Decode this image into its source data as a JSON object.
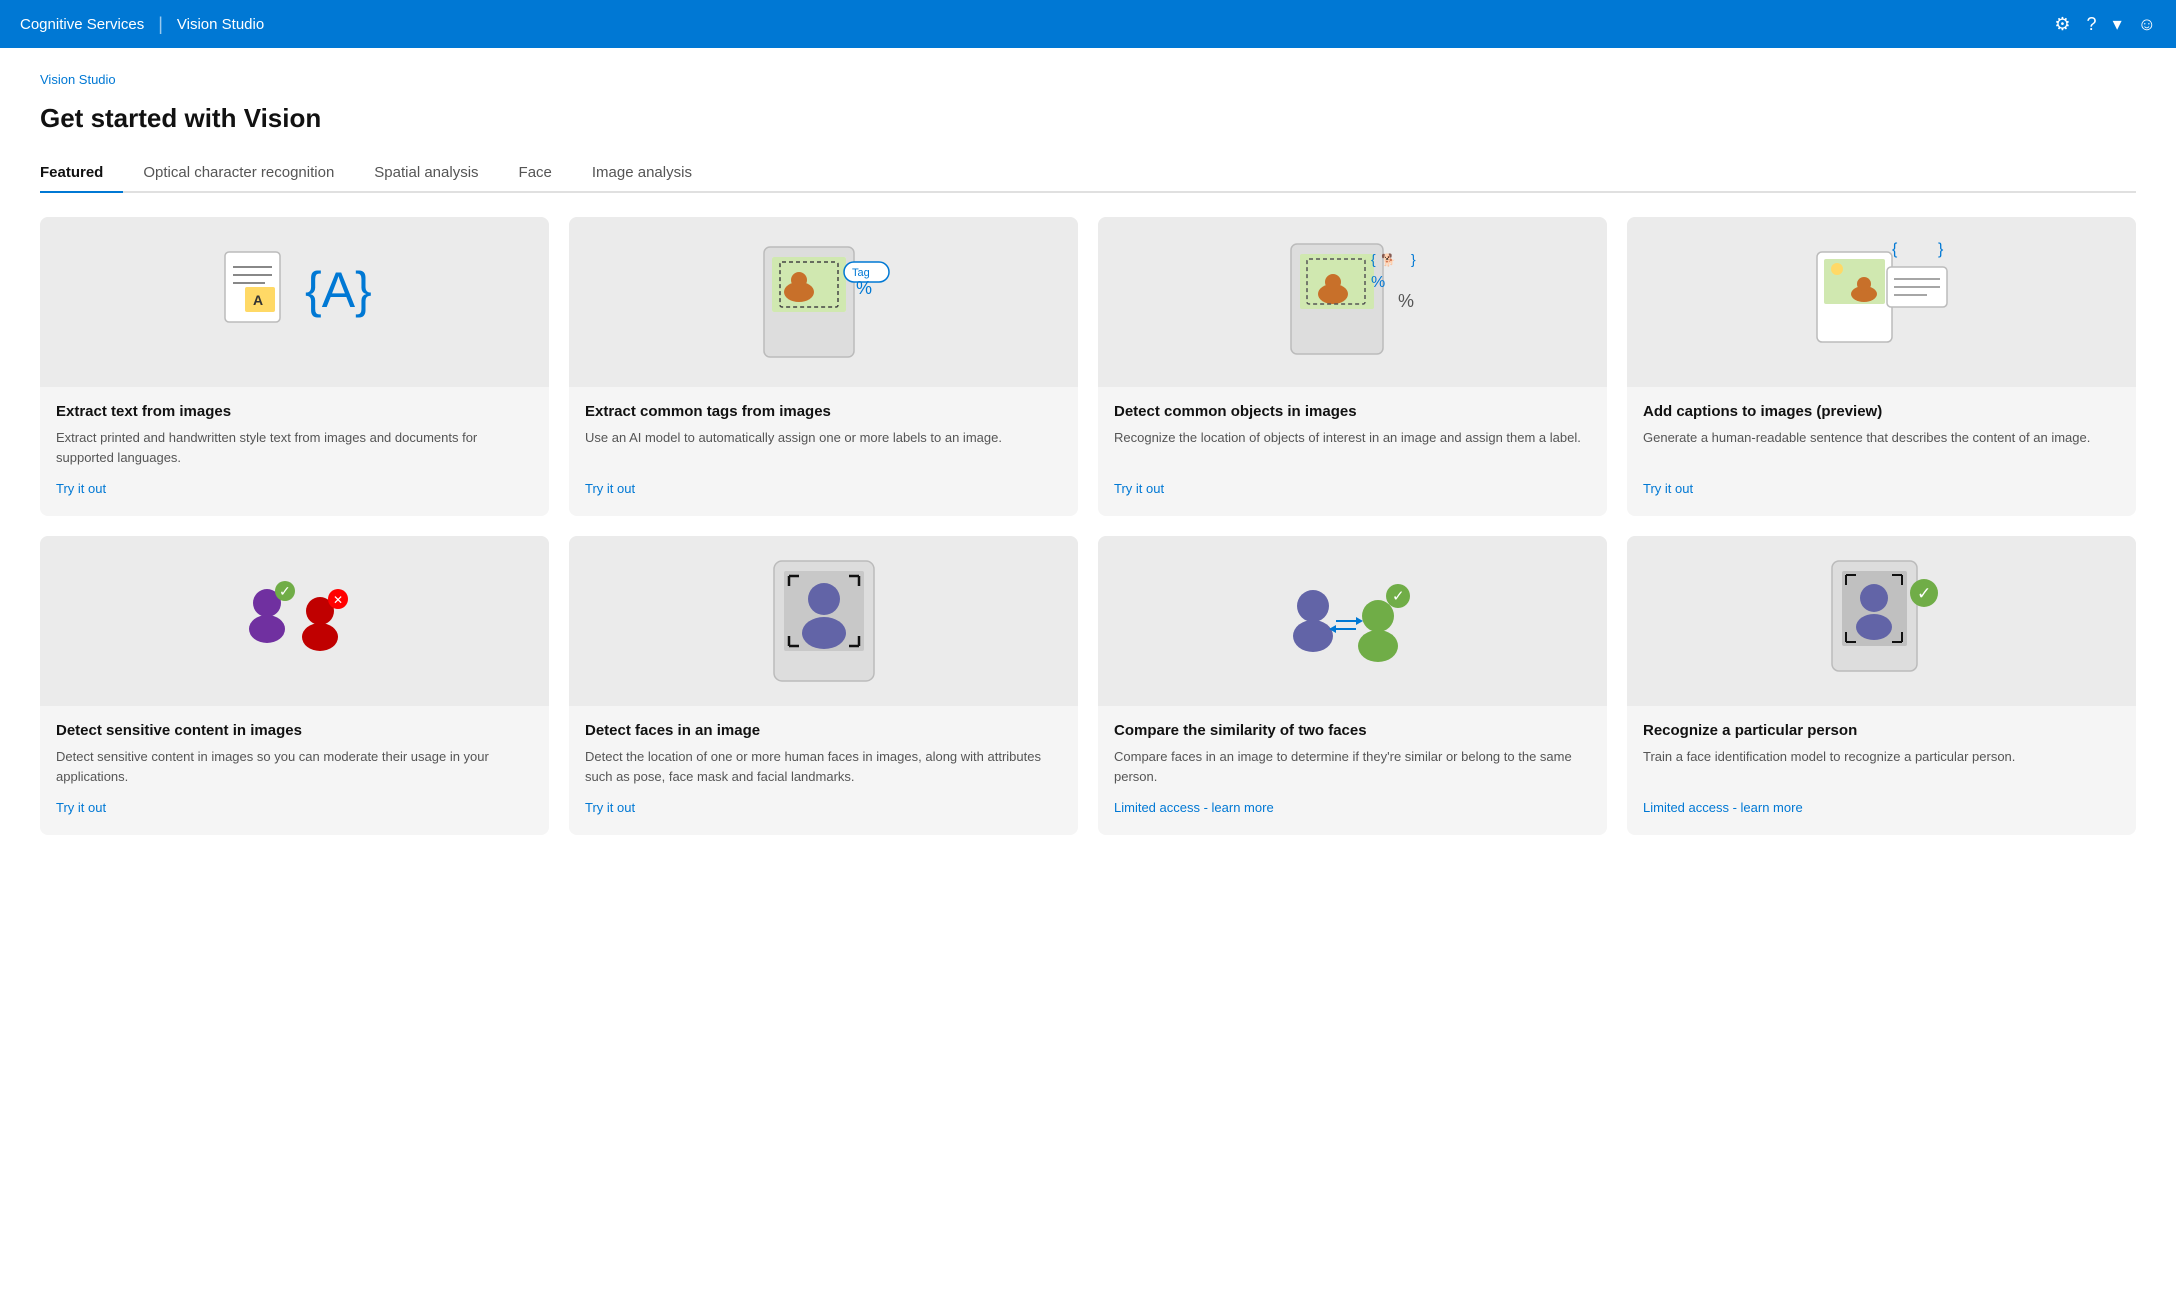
{
  "topnav": {
    "app_name": "Cognitive Services",
    "divider": "|",
    "product_name": "Vision Studio",
    "icons": [
      "gear-icon",
      "question-icon",
      "chevron-icon",
      "face-icon"
    ]
  },
  "breadcrumb": "Vision Studio",
  "page_title": "Get started with Vision",
  "tabs": [
    {
      "label": "Featured",
      "active": true
    },
    {
      "label": "Optical character recognition",
      "active": false
    },
    {
      "label": "Spatial analysis",
      "active": false
    },
    {
      "label": "Face",
      "active": false
    },
    {
      "label": "Image analysis",
      "active": false
    }
  ],
  "card_rows": [
    [
      {
        "id": "extract-text",
        "title": "Extract text from images",
        "description": "Extract printed and handwritten style text from images and documents for supported languages.",
        "link_label": "Try it out"
      },
      {
        "id": "extract-tags",
        "title": "Extract common tags from images",
        "description": "Use an AI model to automatically assign one or more labels to an image.",
        "link_label": "Try it out"
      },
      {
        "id": "detect-objects",
        "title": "Detect common objects in images",
        "description": "Recognize the location of objects of interest in an image and assign them a label.",
        "link_label": "Try it out"
      },
      {
        "id": "add-captions",
        "title": "Add captions to images (preview)",
        "description": "Generate a human-readable sentence that describes the content of an image.",
        "link_label": "Try it out"
      }
    ],
    [
      {
        "id": "detect-sensitive",
        "title": "Detect sensitive content in images",
        "description": "Detect sensitive content in images so you can moderate their usage in your applications.",
        "link_label": "Try it out"
      },
      {
        "id": "detect-faces",
        "title": "Detect faces in an image",
        "description": "Detect the location of one or more human faces in images, along with attributes such as pose, face mask and facial landmarks.",
        "link_label": "Try it out"
      },
      {
        "id": "compare-faces",
        "title": "Compare the similarity of two faces",
        "description": "Compare faces in an image to determine if they're similar or belong to the same person.",
        "link_label": "Limited access - learn more"
      },
      {
        "id": "recognize-person",
        "title": "Recognize a particular person",
        "description": "Train a face identification model to recognize a particular person.",
        "link_label": "Limited access - learn more"
      }
    ]
  ]
}
